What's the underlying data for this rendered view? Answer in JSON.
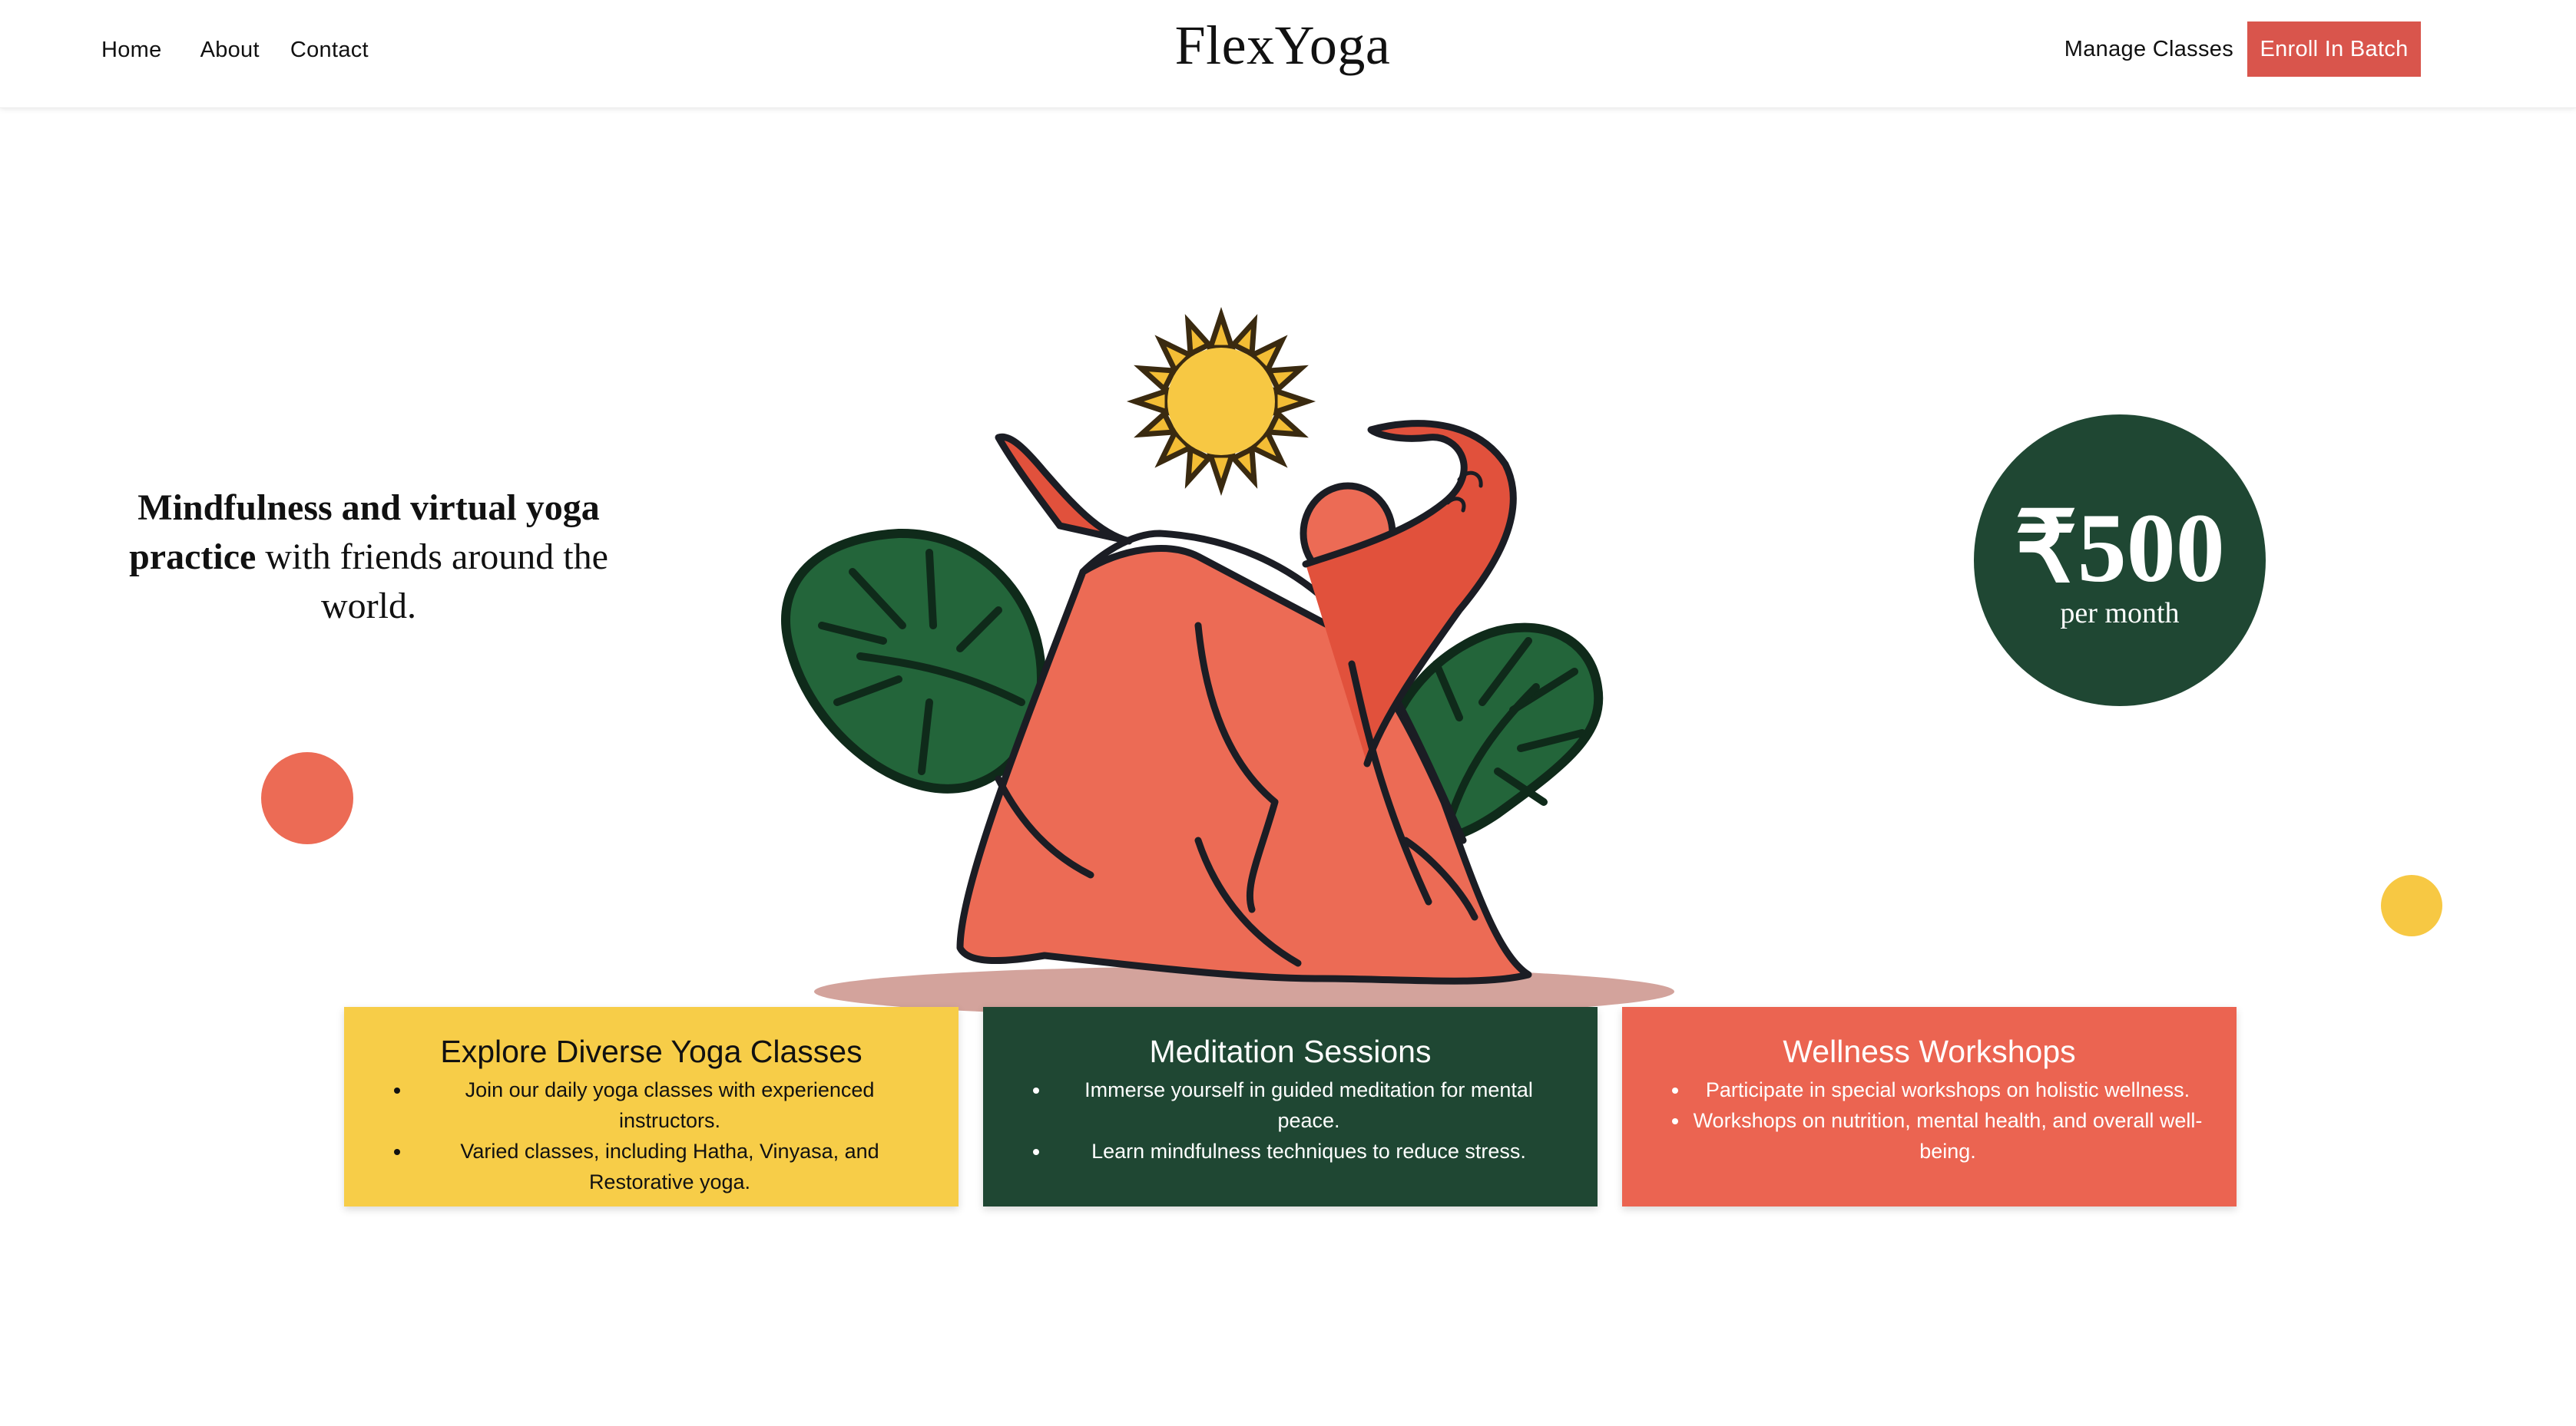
{
  "header": {
    "nav": {
      "home": "Home",
      "about": "About",
      "contact": "Contact"
    },
    "logo": "FlexYoga",
    "manage_label": "Manage Classes",
    "enroll_label": "Enroll In Batch"
  },
  "hero": {
    "tagline_bold": "Mindfulness and virtual yoga practice",
    "tagline_rest": " with friends around the world.",
    "price": {
      "amount": "₹500",
      "period": "per month"
    }
  },
  "cards": [
    {
      "title": "Explore Diverse Yoga Classes",
      "points": [
        "Join our daily yoga classes with experienced instructors.",
        "Varied classes, including Hatha, Vinyasa, and Restorative yoga."
      ]
    },
    {
      "title": "Meditation Sessions",
      "points": [
        "Immerse yourself in guided meditation for mental peace.",
        "Learn mindfulness techniques to reduce stress."
      ]
    },
    {
      "title": "Wellness Workshops",
      "points": [
        "Participate in special workshops on holistic wellness.",
        "Workshops on nutrition, mental health, and overall well-being."
      ]
    }
  ],
  "colors": {
    "brand_red": "#d9554c",
    "dark_green": "#1f4733",
    "yellow": "#f7cd48",
    "coral": "#eb6451"
  }
}
